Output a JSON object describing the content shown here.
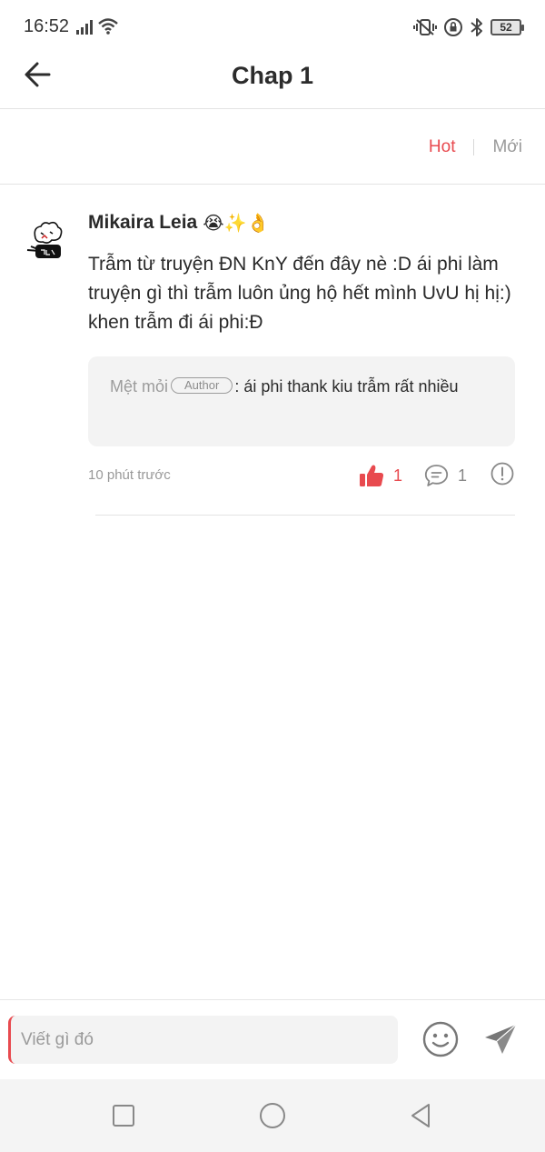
{
  "status_bar": {
    "time": "16:52",
    "battery": "52"
  },
  "header": {
    "title": "Chap 1"
  },
  "sort": {
    "hot": "Hot",
    "new": "Mới"
  },
  "comment": {
    "author": "Mikaira Leia",
    "emojis": "😭✨👌",
    "text": "Trẫm từ truyện ĐN KnY đến đây nè :D ái phi làm truyện gì thì trẫm luôn ủng hộ hết mình UvU hị hị:) khen trẫm đi ái phi:Đ",
    "reply": {
      "author": "Mệt mỏi",
      "badge": "Author",
      "separator": ":",
      "text": "ái phi thank kiu trẫm rất nhiều"
    },
    "time": "10 phút trước",
    "likes": "1",
    "replies": "1"
  },
  "input": {
    "placeholder": "Viết gì đó"
  },
  "colors": {
    "accent": "#e84a4f",
    "muted": "#9a9a9a"
  }
}
